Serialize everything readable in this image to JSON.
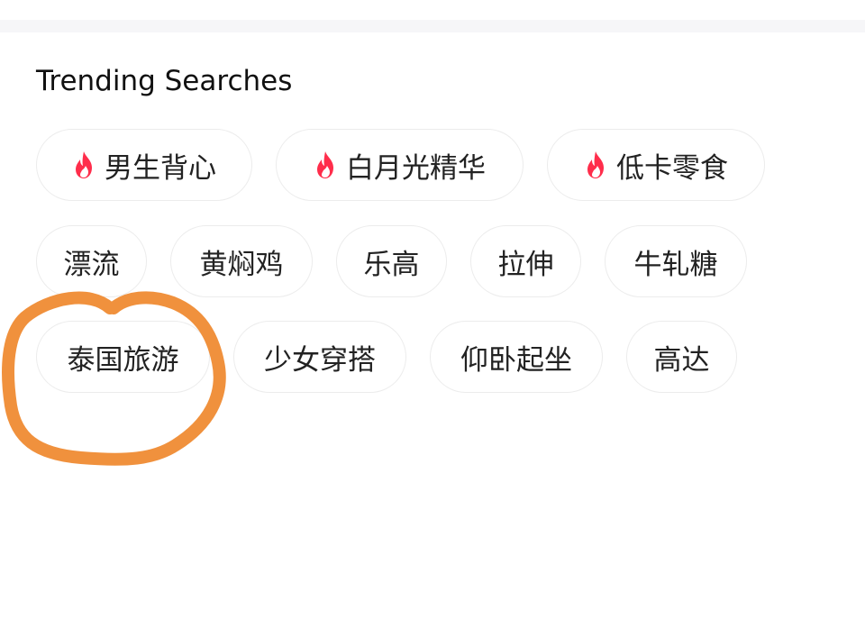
{
  "section": {
    "title": "Trending Searches"
  },
  "colors": {
    "fire_icon": "#ff2d4b",
    "annotation_stroke": "#f0913d"
  },
  "chips": [
    {
      "label": "男生背心",
      "hot": true,
      "icon": "fire-icon"
    },
    {
      "label": "白月光精华",
      "hot": true,
      "icon": "fire-icon"
    },
    {
      "label": "低卡零食",
      "hot": true,
      "icon": "fire-icon"
    },
    {
      "label": "漂流",
      "hot": false
    },
    {
      "label": "黄焖鸡",
      "hot": false
    },
    {
      "label": "乐高",
      "hot": false
    },
    {
      "label": "拉伸",
      "hot": false
    },
    {
      "label": "牛轧糖",
      "hot": false
    },
    {
      "label": "泰国旅游",
      "hot": false
    },
    {
      "label": "少女穿搭",
      "hot": false
    },
    {
      "label": "仰卧起坐",
      "hot": false
    },
    {
      "label": "高达",
      "hot": false
    }
  ]
}
